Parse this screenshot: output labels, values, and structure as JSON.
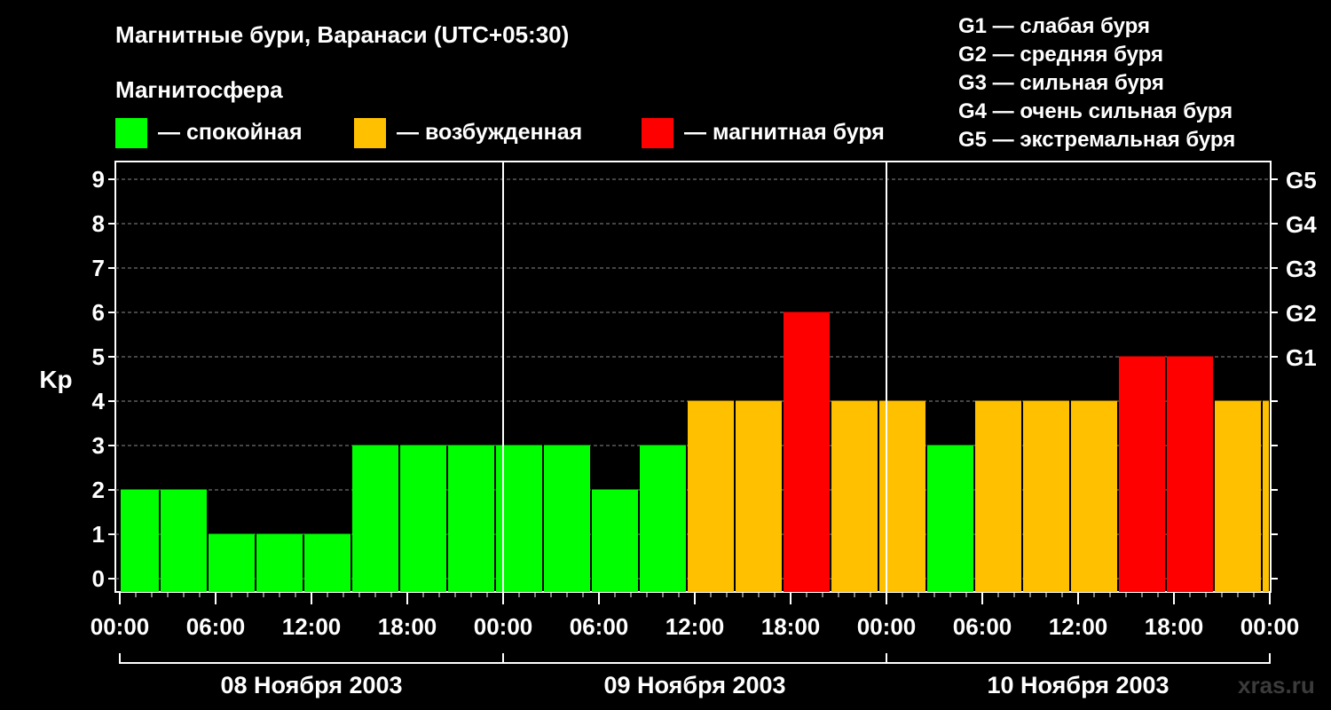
{
  "title": "Магнитные бури, Варанаси (UTC+05:30)",
  "subtitle": "Магнитосфера",
  "legend": [
    {
      "label": "— спокойная",
      "color": "#00ff00"
    },
    {
      "label": "— возбужденная",
      "color": "#ffc000"
    },
    {
      "label": "— магнитная буря",
      "color": "#ff0000"
    }
  ],
  "storm_levels": [
    "G1 — слабая буря",
    "G2 — средняя буря",
    "G3 — сильная буря",
    "G4 — очень сильная буря",
    "G5 — экстремальная буря"
  ],
  "watermark": "xras.ru",
  "chart_data": {
    "type": "bar",
    "ylabel": "Kp",
    "ylim": [
      0,
      9
    ],
    "y_ticks": [
      "0",
      "1",
      "2",
      "3",
      "4",
      "5",
      "6",
      "7",
      "8",
      "9"
    ],
    "right_ticks": [
      {
        "value": 5,
        "label": "G1"
      },
      {
        "value": 6,
        "label": "G2"
      },
      {
        "value": 7,
        "label": "G3"
      },
      {
        "value": 8,
        "label": "G4"
      },
      {
        "value": 9,
        "label": "G5"
      }
    ],
    "x_tick_labels": [
      "00:00",
      "06:00",
      "12:00",
      "18:00",
      "00:00",
      "06:00",
      "12:00",
      "18:00",
      "00:00",
      "06:00",
      "12:00",
      "18:00",
      "00:00"
    ],
    "day_labels": [
      "08 Ноября 2003",
      "09 Ноября 2003",
      "10 Ноября 2003"
    ],
    "grid": true,
    "colors": {
      "quiet": "#00ff00",
      "active": "#ffc000",
      "storm": "#ff0000"
    },
    "bars": [
      {
        "start": "08 Ноября 2003 00:00",
        "end": "08 Ноября 2003 02:30",
        "kp": 2,
        "level": "quiet"
      },
      {
        "start": "08 Ноября 2003 02:30",
        "end": "08 Ноября 2003 05:30",
        "kp": 2,
        "level": "quiet"
      },
      {
        "start": "08 Ноября 2003 05:30",
        "end": "08 Ноября 2003 08:30",
        "kp": 1,
        "level": "quiet"
      },
      {
        "start": "08 Ноября 2003 08:30",
        "end": "08 Ноября 2003 11:30",
        "kp": 1,
        "level": "quiet"
      },
      {
        "start": "08 Ноября 2003 11:30",
        "end": "08 Ноября 2003 14:30",
        "kp": 1,
        "level": "quiet"
      },
      {
        "start": "08 Ноября 2003 14:30",
        "end": "08 Ноября 2003 17:30",
        "kp": 3,
        "level": "quiet"
      },
      {
        "start": "08 Ноября 2003 17:30",
        "end": "08 Ноября 2003 20:30",
        "kp": 3,
        "level": "quiet"
      },
      {
        "start": "08 Ноября 2003 20:30",
        "end": "08 Ноября 2003 23:30",
        "kp": 3,
        "level": "quiet"
      },
      {
        "start": "08 Ноября 2003 23:30",
        "end": "09 Ноября 2003 02:30",
        "kp": 3,
        "level": "quiet"
      },
      {
        "start": "09 Ноября 2003 02:30",
        "end": "09 Ноября 2003 05:30",
        "kp": 3,
        "level": "quiet"
      },
      {
        "start": "09 Ноября 2003 05:30",
        "end": "09 Ноября 2003 08:30",
        "kp": 2,
        "level": "quiet"
      },
      {
        "start": "09 Ноября 2003 08:30",
        "end": "09 Ноября 2003 11:30",
        "kp": 3,
        "level": "quiet"
      },
      {
        "start": "09 Ноября 2003 11:30",
        "end": "09 Ноября 2003 14:30",
        "kp": 4,
        "level": "active"
      },
      {
        "start": "09 Ноября 2003 14:30",
        "end": "09 Ноября 2003 17:30",
        "kp": 4,
        "level": "active"
      },
      {
        "start": "09 Ноября 2003 17:30",
        "end": "09 Ноября 2003 20:30",
        "kp": 6,
        "level": "storm"
      },
      {
        "start": "09 Ноября 2003 20:30",
        "end": "09 Ноября 2003 23:30",
        "kp": 4,
        "level": "active"
      },
      {
        "start": "09 Ноября 2003 23:30",
        "end": "10 Ноября 2003 02:30",
        "kp": 4,
        "level": "active"
      },
      {
        "start": "10 Ноября 2003 02:30",
        "end": "10 Ноября 2003 05:30",
        "kp": 3,
        "level": "quiet"
      },
      {
        "start": "10 Ноября 2003 05:30",
        "end": "10 Ноября 2003 08:30",
        "kp": 4,
        "level": "active"
      },
      {
        "start": "10 Ноября 2003 08:30",
        "end": "10 Ноября 2003 11:30",
        "kp": 4,
        "level": "active"
      },
      {
        "start": "10 Ноября 2003 11:30",
        "end": "10 Ноября 2003 14:30",
        "kp": 4,
        "level": "active"
      },
      {
        "start": "10 Ноября 2003 14:30",
        "end": "10 Ноября 2003 17:30",
        "kp": 5,
        "level": "storm"
      },
      {
        "start": "10 Ноября 2003 17:30",
        "end": "10 Ноября 2003 20:30",
        "kp": 5,
        "level": "storm"
      },
      {
        "start": "10 Ноября 2003 20:30",
        "end": "10 Ноября 2003 23:30",
        "kp": 4,
        "level": "active"
      },
      {
        "start": "10 Ноября 2003 23:30",
        "end": "11 Ноября 2003 00:00",
        "kp": 4,
        "level": "active"
      }
    ]
  }
}
